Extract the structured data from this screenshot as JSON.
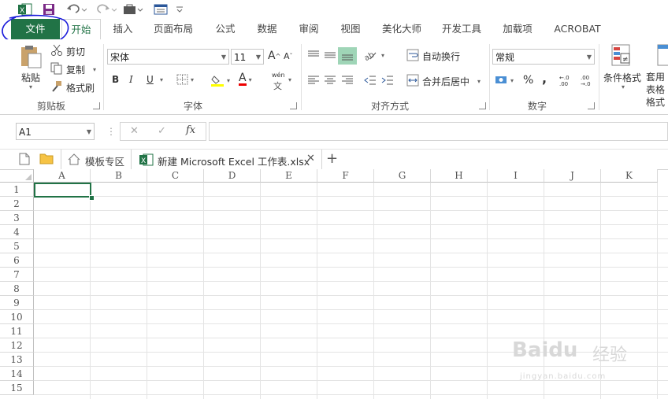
{
  "quick_access": {
    "app_icon": "excel-icon",
    "icons": [
      "save-icon",
      "undo-icon",
      "redo-icon",
      "briefcase-icon",
      "form-icon",
      "customize-arrow-icon"
    ]
  },
  "tabs": [
    {
      "label": "文件"
    },
    {
      "label": "开始"
    },
    {
      "label": "插入"
    },
    {
      "label": "页面布局"
    },
    {
      "label": "公式"
    },
    {
      "label": "数据"
    },
    {
      "label": "审阅"
    },
    {
      "label": "视图"
    },
    {
      "label": "美化大师"
    },
    {
      "label": "开发工具"
    },
    {
      "label": "加载项"
    },
    {
      "label": "ACROBAT"
    }
  ],
  "clipboard": {
    "paste": "粘贴",
    "cut": "剪切",
    "copy": "复制",
    "format_painter": "格式刷",
    "group_label": "剪贴板"
  },
  "font": {
    "name": "宋体",
    "size": "11",
    "bold": "B",
    "italic": "I",
    "underline": "U",
    "grow": "A",
    "shrink": "A",
    "font_color_letter": "A",
    "phonetic": "wén",
    "group_label": "字体"
  },
  "alignment": {
    "wrap": "自动换行",
    "merge": "合并后居中",
    "group_label": "对齐方式"
  },
  "number": {
    "format": "常规",
    "percent": "%",
    "comma": ",",
    "inc_decimal": "←.0 .00",
    "dec_decimal": ".00 →.0",
    "group_label": "数字"
  },
  "styles": {
    "conditional": "条件格式",
    "table_format": "套用表格格式"
  },
  "formula_bar": {
    "name_box": "A1",
    "cancel": "✕",
    "enter": "✓",
    "fx": "fx",
    "value": ""
  },
  "doc_tabs": {
    "template": "模板专区",
    "workbook": "新建 Microsoft Excel 工作表.xlsx",
    "close": "✕",
    "new": "+"
  },
  "columns": [
    "A",
    "B",
    "C",
    "D",
    "E",
    "F",
    "G",
    "H",
    "I",
    "J",
    "K"
  ],
  "rows": [
    "1",
    "2",
    "3",
    "4",
    "5",
    "6",
    "7",
    "8",
    "9",
    "10",
    "11",
    "12",
    "13",
    "14",
    "15"
  ],
  "watermark": {
    "logo": "Baidu",
    "suffix": "经验",
    "url": "jingyan.baidu.com"
  },
  "accent": "#217346",
  "annotation_color": "#1a1adb"
}
